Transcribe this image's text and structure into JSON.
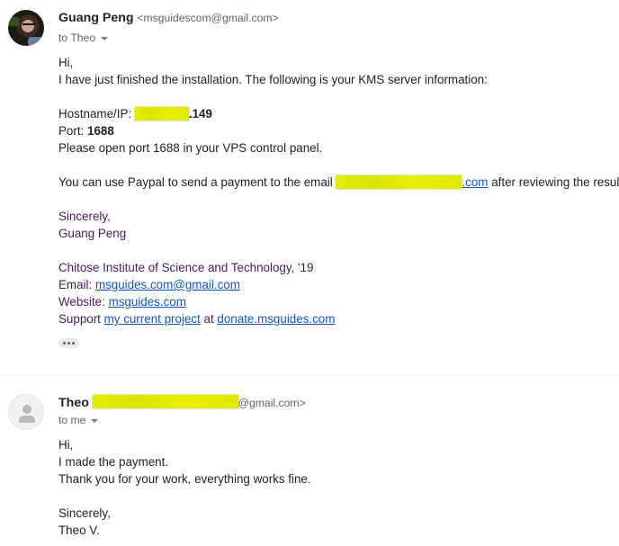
{
  "messages": [
    {
      "sender_name": "Guang Peng",
      "sender_email": "<msguidescom@gmail.com>",
      "to_line": "to Theo",
      "avatar": "profile-photo",
      "body": {
        "greeting": "Hi,",
        "intro": "I have just finished the installation. The following is your KMS server information:",
        "hostname_label": "Hostname/IP: ",
        "hostname_suffix": ".149",
        "port_label": "Port: ",
        "port_value": "1688",
        "port_note": "Please open port 1688 in your VPS control panel.",
        "paypal_prefix": "You can use Paypal to send a payment to the email ",
        "paypal_email_suffix": ".com",
        "paypal_suffix": " after reviewing the result.",
        "closing": "Sincerely,",
        "signoff": "Guang Peng"
      },
      "signature": {
        "institution": "Chitose Institute of Science and Technology, '19",
        "email_label": "Email: ",
        "email_link": "msguides.com@gmail.com",
        "website_label": "Website: ",
        "website_link": "msguides.com",
        "support_label": "Support ",
        "support_link": "my current project",
        "support_at": " at ",
        "donate_link": "donate.msguides.com"
      },
      "show_trimmed_icon": "ellipsis-icon"
    },
    {
      "sender_name": "Theo",
      "sender_email_suffix": "@gmail.com>",
      "to_line": "to me",
      "avatar": "generic-person-icon",
      "body": {
        "greeting": "Hi,",
        "line1": "I made the payment.",
        "line2": "Thank you for your work, everything works fine.",
        "closing": "Sincerely,",
        "signoff": "Theo V."
      }
    }
  ],
  "colors": {
    "link": "#1155cc",
    "signature_text": "#4a1a5a",
    "redaction_highlight": "#e4ee00",
    "secondary_text": "#5f6368"
  }
}
